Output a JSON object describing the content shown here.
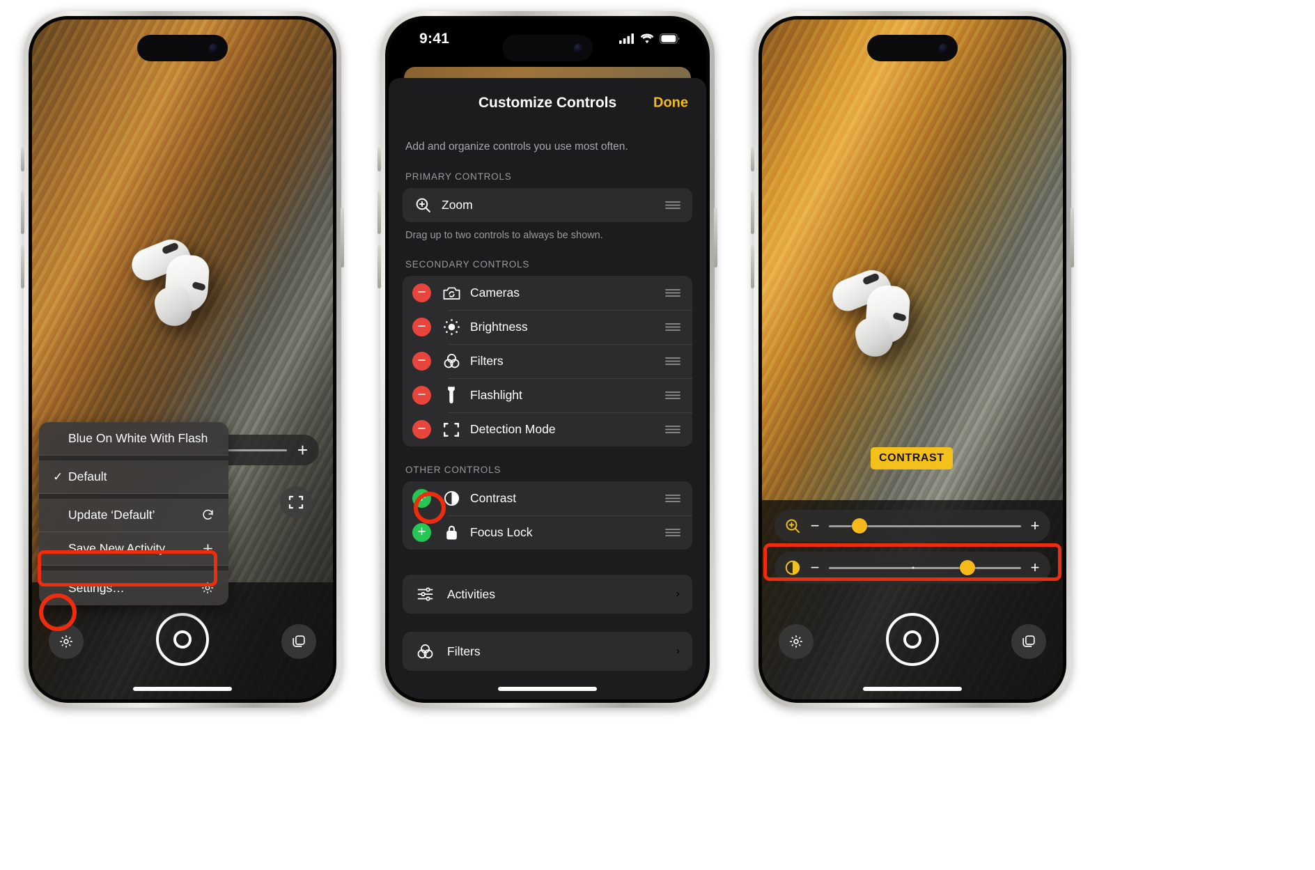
{
  "phone1": {
    "name": "Magnifier camera view with activity context menu",
    "context_menu": {
      "items": [
        {
          "label": "Blue On White With Flash",
          "check": "",
          "trailing_icon": ""
        },
        {
          "label": "Default",
          "check": "✓",
          "trailing_icon": ""
        },
        {
          "label": "Update ‘Default’",
          "check": "",
          "trailing_icon": "refresh-icon"
        },
        {
          "label": "Save New Activity",
          "check": "",
          "trailing_icon": "plus-icon"
        },
        {
          "label": "Settings…",
          "check": "",
          "trailing_icon": "gear-icon"
        }
      ],
      "highlighted_item": "Settings…"
    },
    "toolbar": {
      "plus_label": "+",
      "flashlight_icon": "flashlight-icon",
      "detection_icon": "detection-mode-icon",
      "settings_icon": "gear-icon",
      "shutter_icon": "shutter-button",
      "layers_icon": "layers-icon"
    }
  },
  "phone2": {
    "status_bar": {
      "time": "9:41",
      "signal_icon": "cellular-signal-icon",
      "wifi_icon": "wifi-icon",
      "battery_icon": "battery-icon"
    },
    "sheet": {
      "title": "Customize Controls",
      "done_label": "Done",
      "subtitle": "Add and organize controls you use most often.",
      "sections": [
        {
          "header": "PRIMARY CONTROLS",
          "footer": "Drag up to two controls to always be shown.",
          "rows": [
            {
              "label": "Zoom",
              "icon": "zoom-in-icon",
              "badge": "none",
              "grip": true
            }
          ]
        },
        {
          "header": "SECONDARY CONTROLS",
          "footer": "",
          "rows": [
            {
              "label": "Cameras",
              "icon": "camera-flip-icon",
              "badge": "remove",
              "grip": true
            },
            {
              "label": "Brightness",
              "icon": "brightness-icon",
              "badge": "remove",
              "grip": true
            },
            {
              "label": "Filters",
              "icon": "filters-icon",
              "badge": "remove",
              "grip": true
            },
            {
              "label": "Flashlight",
              "icon": "flashlight-icon",
              "badge": "remove",
              "grip": true
            },
            {
              "label": "Detection Mode",
              "icon": "detection-mode-icon",
              "badge": "remove",
              "grip": true
            }
          ]
        },
        {
          "header": "OTHER CONTROLS",
          "footer": "",
          "rows": [
            {
              "label": "Contrast",
              "icon": "contrast-icon",
              "badge": "add",
              "grip": true,
              "highlighted": true
            },
            {
              "label": "Focus Lock",
              "icon": "lock-icon",
              "badge": "add",
              "grip": true
            }
          ]
        }
      ],
      "nav_rows": [
        {
          "label": "Activities",
          "icon": "sliders-icon",
          "chevron": "›"
        },
        {
          "label": "Filters",
          "icon": "filters-icon",
          "chevron": "›"
        }
      ]
    }
  },
  "phone3": {
    "name": "Magnifier camera view with zoom and contrast sliders",
    "badge": {
      "label": "CONTRAST"
    },
    "sliders": [
      {
        "name": "zoom-slider",
        "icon": "zoom-in-icon",
        "minus_label": "−",
        "plus_label": "+",
        "value_percent": 16,
        "tick_percent": null
      },
      {
        "name": "contrast-slider",
        "icon": "contrast-icon",
        "minus_label": "−",
        "plus_label": "+",
        "value_percent": 72,
        "tick_percent": 44,
        "highlighted": true
      }
    ],
    "toolbar": {
      "settings_icon": "gear-icon",
      "shutter_icon": "shutter-button",
      "layers_icon": "layers-icon"
    }
  },
  "colors": {
    "accent_yellow": "#f3c01c",
    "annotation_red": "#ee2d0f",
    "remove_red": "#e8453c",
    "add_green": "#25c653",
    "sheet_bg": "#1c1c1e",
    "row_bg": "#2c2c2e"
  }
}
